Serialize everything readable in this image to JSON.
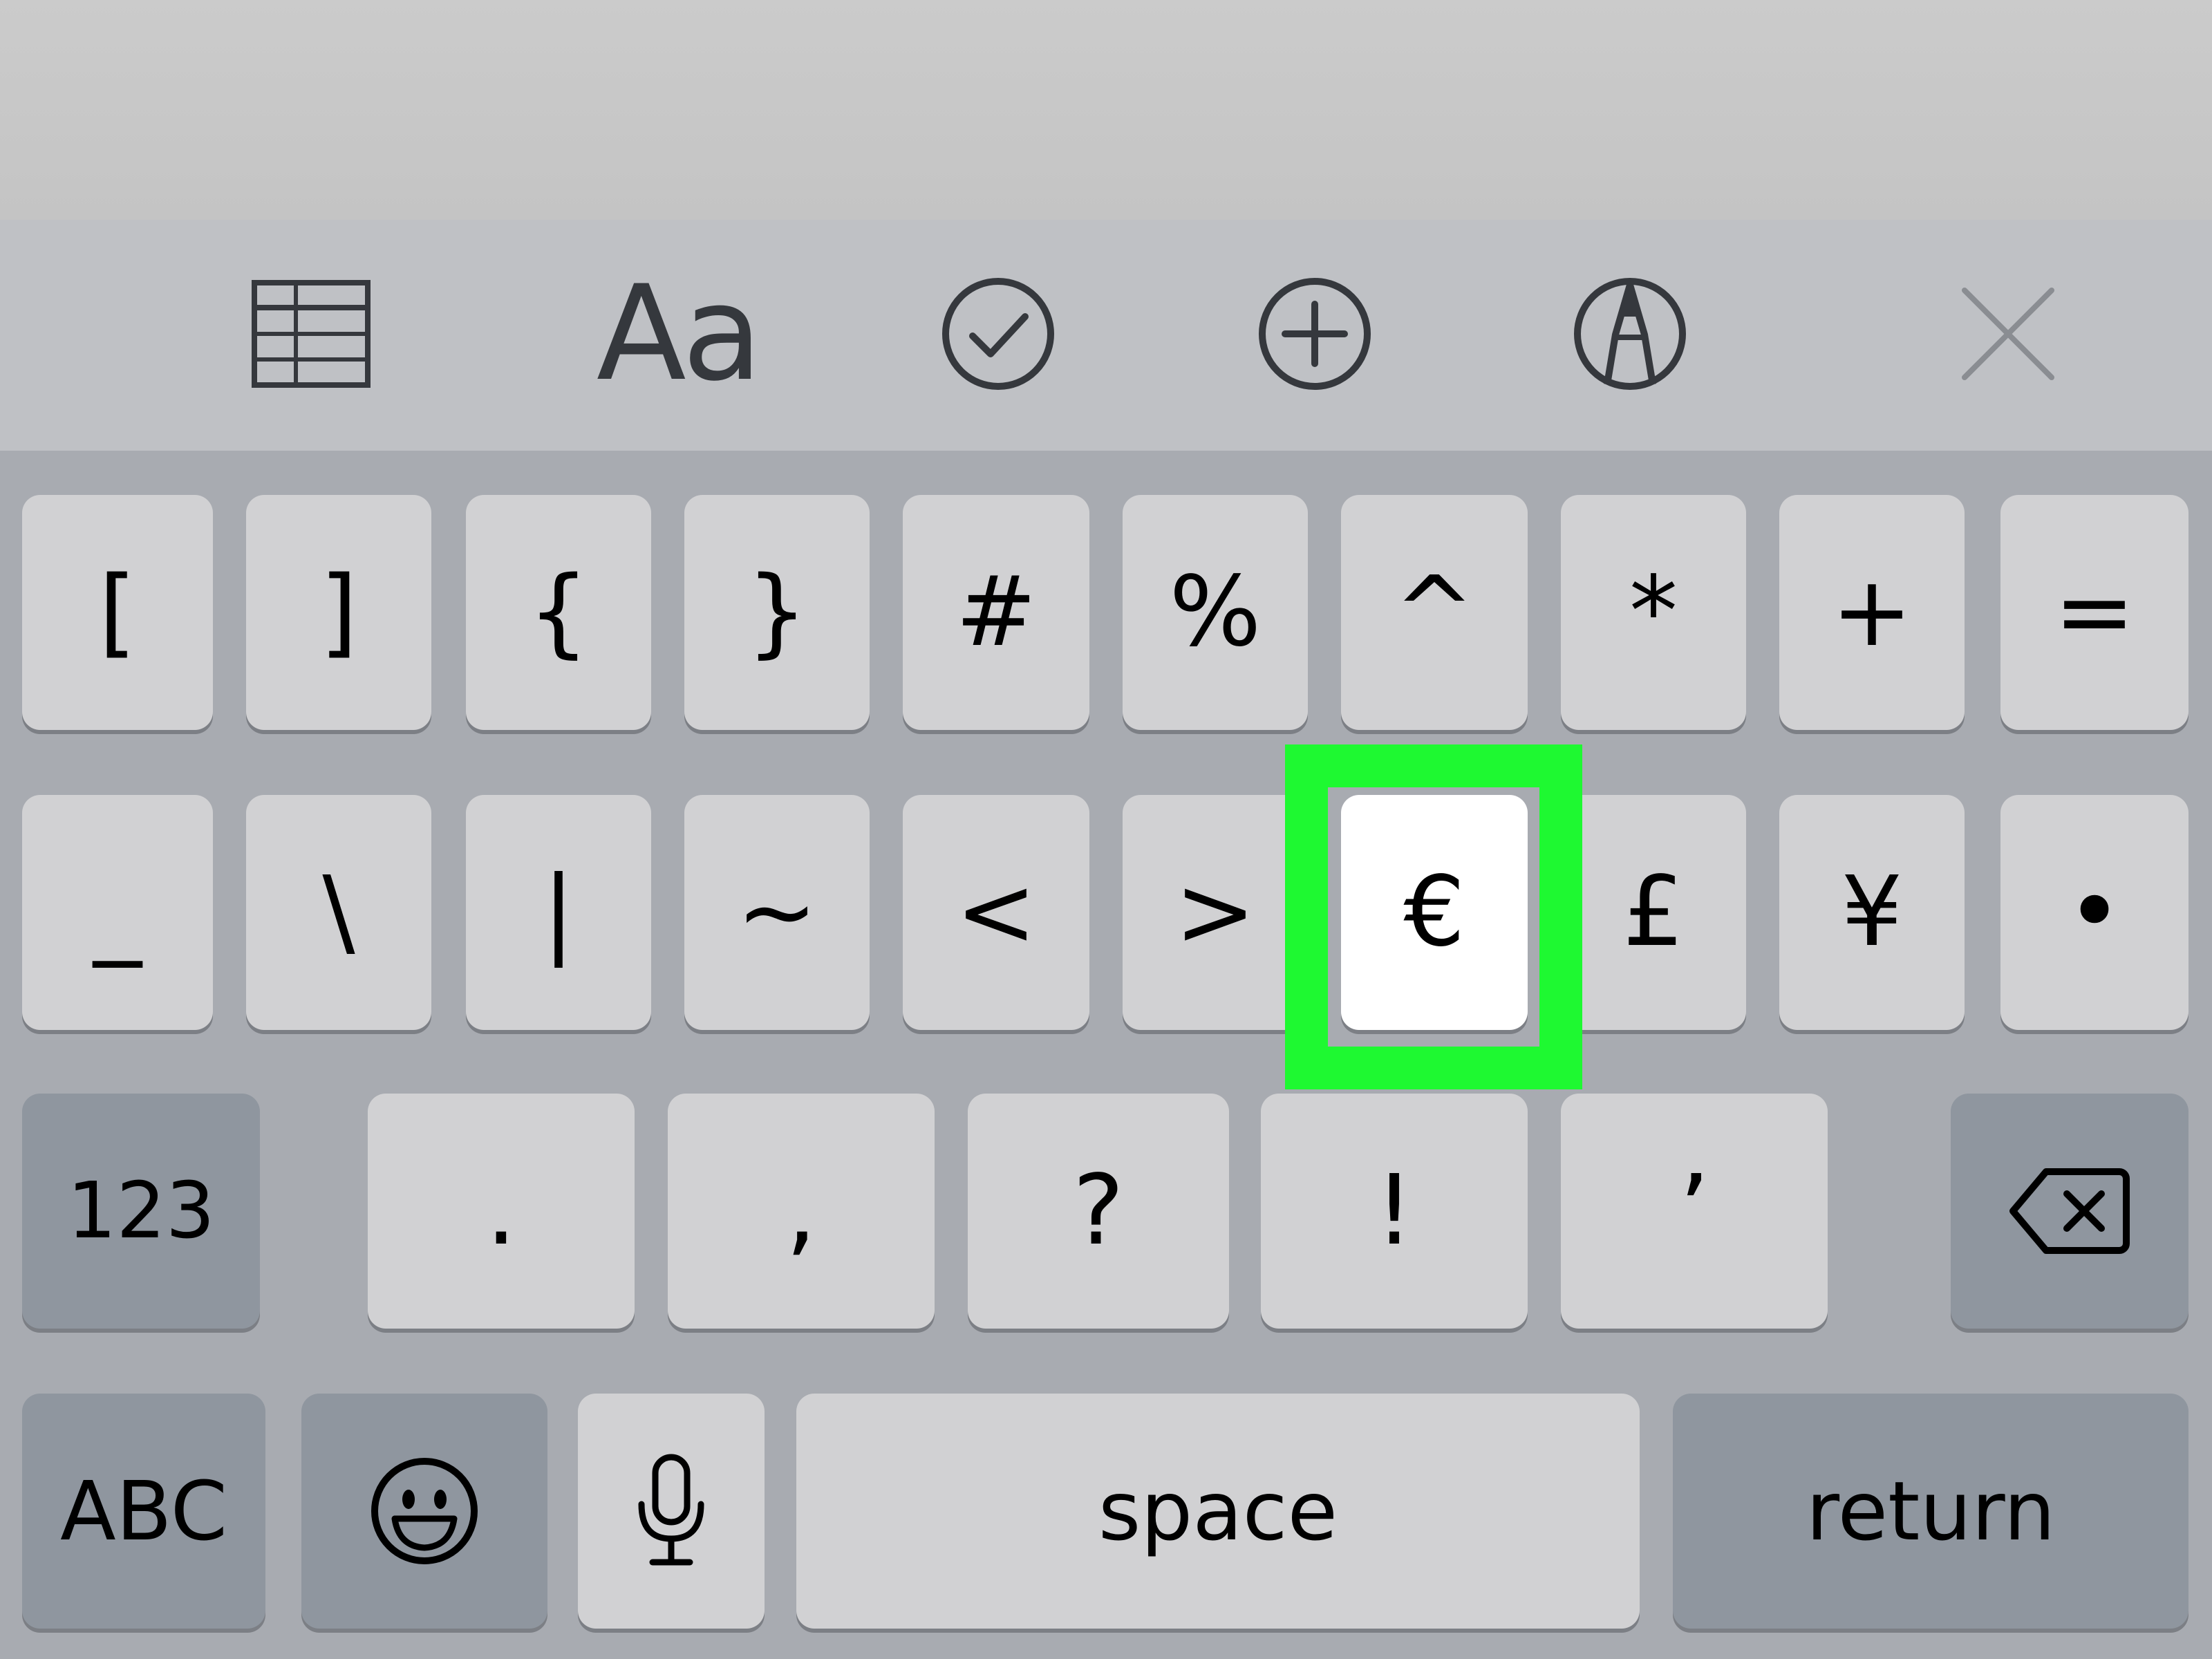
{
  "toolbar": {
    "icons": [
      "table-icon",
      "text-format-icon",
      "checklist-icon",
      "insert-icon",
      "markup-icon",
      "close-icon"
    ],
    "text_format_label": "Aa"
  },
  "keyboard": {
    "row1": [
      "[",
      "]",
      "{",
      "}",
      "#",
      "%",
      "^",
      "*",
      "+",
      "="
    ],
    "row2": [
      "_",
      "\\",
      "|",
      "~",
      "<",
      ">",
      "€",
      "£",
      "¥",
      "•"
    ],
    "row3": [
      ".",
      ",",
      "?",
      "!",
      "’"
    ],
    "mode_123": "123",
    "mode_abc": "ABC",
    "space": "space",
    "return": "return",
    "highlighted_key": "€",
    "highlight_color": "#1ef931",
    "icons": [
      "delete-icon",
      "emoji-icon",
      "microphone-icon"
    ]
  }
}
